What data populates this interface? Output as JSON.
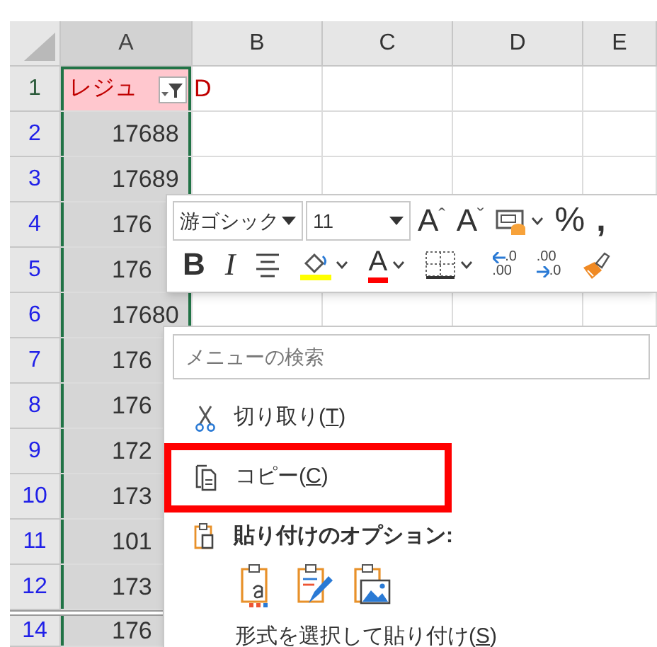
{
  "columns": [
    {
      "label": "A",
      "selected": true
    },
    {
      "label": "B",
      "selected": false
    },
    {
      "label": "C",
      "selected": false
    },
    {
      "label": "D",
      "selected": false
    },
    {
      "label": "E",
      "selected": false
    }
  ],
  "rows": [
    {
      "number": "1",
      "kind": "header",
      "filtered": false,
      "a": "レジュ",
      "b": "D"
    },
    {
      "number": "2",
      "kind": "data",
      "filtered": true,
      "a": "17688"
    },
    {
      "number": "3",
      "kind": "data",
      "filtered": true,
      "a": "17689"
    },
    {
      "number": "4",
      "kind": "data",
      "filtered": true,
      "a": "176"
    },
    {
      "number": "5",
      "kind": "data",
      "filtered": true,
      "a": "176"
    },
    {
      "number": "6",
      "kind": "data",
      "filtered": true,
      "a": "17680"
    },
    {
      "number": "7",
      "kind": "data",
      "filtered": true,
      "a": "176"
    },
    {
      "number": "8",
      "kind": "data",
      "filtered": true,
      "a": "176"
    },
    {
      "number": "9",
      "kind": "data",
      "filtered": true,
      "a": "172"
    },
    {
      "number": "10",
      "kind": "data",
      "filtered": true,
      "a": "173"
    },
    {
      "number": "11",
      "kind": "data",
      "filtered": true,
      "a": "101"
    },
    {
      "number": "12",
      "kind": "data",
      "filtered": true,
      "a": "173"
    },
    {
      "number": "14",
      "kind": "data",
      "filtered": true,
      "hidden_rows_before": true,
      "a": "176"
    }
  ],
  "mini_toolbar": {
    "row_1": [
      {
        "kind": "combo",
        "value": "游ゴシック"
      },
      {
        "kind": "combo",
        "value": "11"
      },
      {
        "kind": "letter",
        "text": "A",
        "mark": "ˆ"
      },
      {
        "kind": "letter",
        "text": "A",
        "mark": "ˇ"
      },
      {
        "kind": "icon",
        "dropdown": true
      },
      {
        "kind": "letter",
        "text": "%"
      },
      {
        "kind": "letter",
        "text": ","
      }
    ],
    "row_2": [
      {
        "kind": "letter",
        "text": "B"
      },
      {
        "kind": "letter",
        "text": "I"
      },
      {
        "kind": "icon"
      },
      {
        "kind": "icon",
        "color": "#ffff00",
        "dropdown": true
      },
      {
        "kind": "letter",
        "text": "A",
        "color": "#ff0000",
        "dropdown": true
      },
      {
        "kind": "icon",
        "dropdown": true
      },
      {
        "kind": "decimal",
        "lines": [
          ".0",
          ".00"
        ]
      },
      {
        "kind": "decimal",
        "lines": [
          ".00",
          ".0"
        ]
      },
      {
        "kind": "icon"
      }
    ]
  },
  "context_menu": {
    "search": {
      "placeholder": "メニューの検索"
    },
    "items": [
      {
        "kind": "command",
        "before": "切り取り(",
        "accel": "T",
        "after": ")",
        "annotated": false
      },
      {
        "kind": "command",
        "before": "コピー(",
        "accel": "C",
        "after": ")",
        "annotated": true
      },
      {
        "kind": "section",
        "label": "貼り付けのオプション:"
      },
      {
        "kind": "paste_icons"
      },
      {
        "kind": "command",
        "before": "形式を選択して貼り付け(",
        "accel": "S",
        "after": ")",
        "annotated": false
      }
    ]
  }
}
